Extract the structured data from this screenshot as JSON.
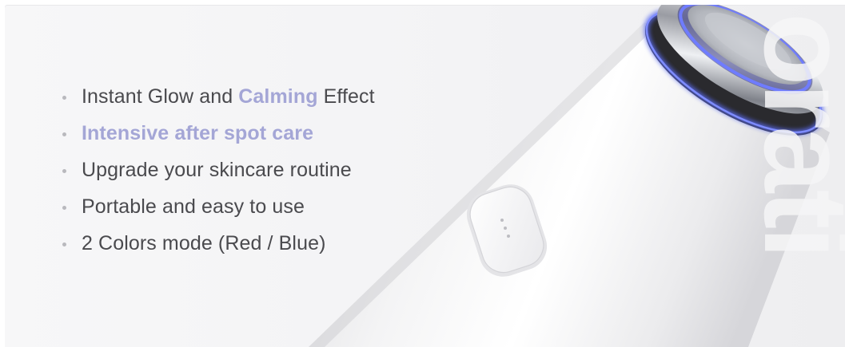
{
  "features": [
    {
      "parts": [
        {
          "text": "Instant Glow and ",
          "style": "normal"
        },
        {
          "text": "Calming",
          "style": "accent"
        },
        {
          "text": " Effect",
          "style": "normal"
        }
      ]
    },
    {
      "parts": [
        {
          "text": "Intensive after spot care",
          "style": "emph"
        }
      ]
    },
    {
      "parts": [
        {
          "text": "Upgrade your skincare routine",
          "style": "normal"
        }
      ]
    },
    {
      "parts": [
        {
          "text": "Portable and easy to use",
          "style": "normal"
        }
      ]
    },
    {
      "parts": [
        {
          "text": "2 Colors mode (Red / Blue)",
          "style": "normal"
        }
      ]
    }
  ],
  "watermark_text": "orati",
  "colors": {
    "accent": "#a4a6d6",
    "body_text": "#4a4a4e",
    "led_blue": "#5b6cf0"
  },
  "icons": {
    "device": "facial-care-device-image",
    "button": "device-power-button"
  }
}
